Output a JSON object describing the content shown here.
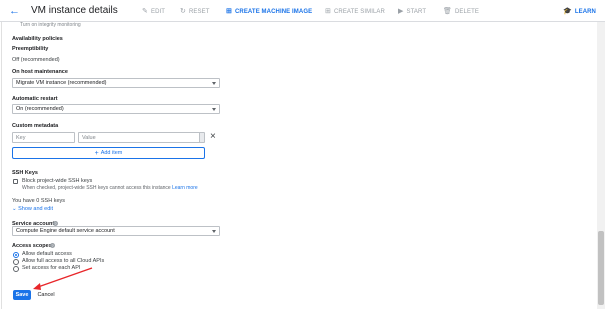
{
  "header": {
    "title": "VM instance details",
    "buttons": {
      "edit": "EDIT",
      "reset": "RESET",
      "create_image": "CREATE MACHINE IMAGE",
      "create_similar": "CREATE SIMILAR",
      "start": "START",
      "delete": "DELETE",
      "learn": "LEARN"
    },
    "colors": {
      "accent": "#1a73e8",
      "disabled": "#9aa0a6"
    }
  },
  "top_cut_text": "Turn on integrity monitoring",
  "availability": {
    "heading": "Availability policies",
    "preemptibility_label": "Preemptibility",
    "preemptibility_value": "Off (recommended)",
    "host_maintenance_label": "On host maintenance",
    "host_maintenance_value": "Migrate VM instance (recommended)",
    "auto_restart_label": "Automatic restart",
    "auto_restart_value": "On (recommended)"
  },
  "metadata": {
    "heading": "Custom metadata",
    "key_placeholder": "Key",
    "value_placeholder": "Value",
    "add_item": "Add item"
  },
  "ssh": {
    "heading": "SSH Keys",
    "block_label": "Block project-wide SSH keys",
    "block_desc": "When checked, project-wide SSH keys cannot access this instance",
    "learn_more": "Learn more",
    "count_text": "You have 0 SSH keys",
    "show_edit": "Show and edit"
  },
  "service_account": {
    "label": "Service account",
    "value": "Compute Engine default service account"
  },
  "access_scopes": {
    "label": "Access scopes",
    "options": [
      "Allow default access",
      "Allow full access to all Cloud APIs",
      "Set access for each API"
    ],
    "selected_index": 0
  },
  "footer": {
    "save": "Save",
    "cancel": "Cancel"
  },
  "annotation_color": "#e8262a"
}
